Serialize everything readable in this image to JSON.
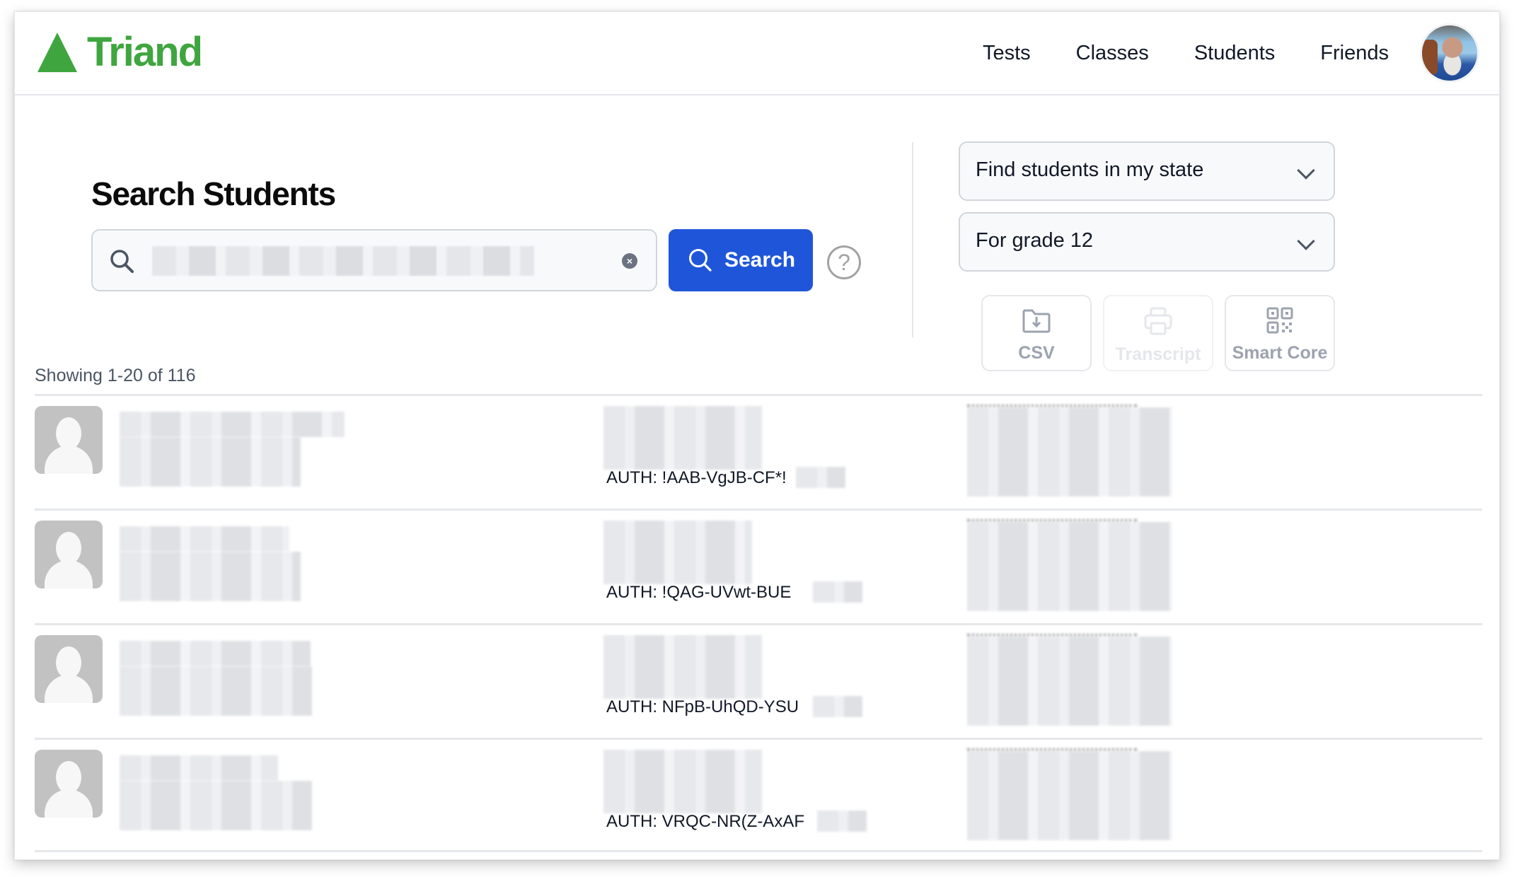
{
  "header": {
    "brand": "Triand",
    "brand_color": "#3fa63f",
    "nav": [
      {
        "label": "Tests"
      },
      {
        "label": "Classes"
      },
      {
        "label": "Students"
      },
      {
        "label": "Friends"
      }
    ],
    "avatar_icon": "user-avatar-photo"
  },
  "search": {
    "title": "Search Students",
    "input_value": "",
    "input_redacted": true,
    "clear_icon": "clear-x-icon",
    "button_label": "Search",
    "button_color": "#1f56d9",
    "help_icon": "question-circle-icon"
  },
  "filters": {
    "scope_select": {
      "selected": "Find students in my state"
    },
    "grade_select": {
      "selected": "For grade 12"
    }
  },
  "tools": [
    {
      "label": "CSV",
      "icon": "folder-download-icon",
      "enabled": true
    },
    {
      "label": "Transcript",
      "icon": "printer-icon",
      "enabled": false
    },
    {
      "label": "Smart Core",
      "icon": "qr-code-icon",
      "enabled": true
    }
  ],
  "results": {
    "showing": "Showing 1-20 of 116",
    "students": [
      {
        "auth": "AUTH: !AAB-VgJB-CF*!",
        "name_redacted": true,
        "school_redacted": true
      },
      {
        "auth": "AUTH: !QAG-UVwt-BUE",
        "name_redacted": true,
        "school_redacted": true
      },
      {
        "auth": "AUTH: NFpB-UhQD-YSU",
        "name_redacted": true,
        "school_redacted": true
      },
      {
        "auth": "AUTH: VRQC-NR(Z-AxAF",
        "name_redacted": true,
        "school_redacted": true
      }
    ]
  }
}
